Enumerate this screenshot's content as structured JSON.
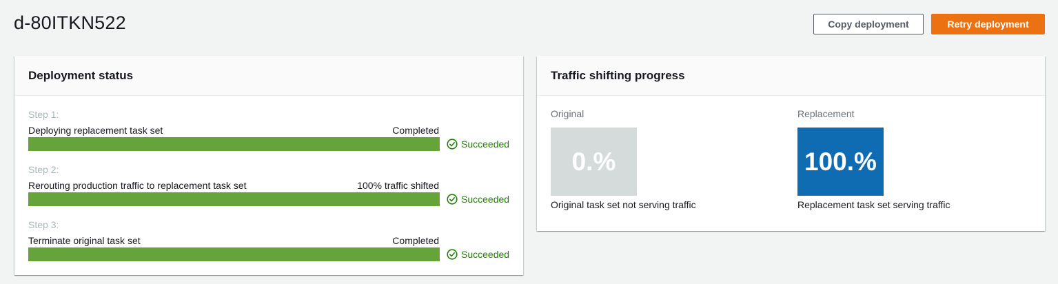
{
  "header": {
    "title": "d-80ITKN522",
    "copy_label": "Copy deployment",
    "retry_label": "Retry deployment"
  },
  "deployment_status": {
    "title": "Deployment status",
    "steps": [
      {
        "title": "Step 1:",
        "description": "Deploying replacement task set",
        "progress_text": "Completed",
        "progress": 1.0,
        "status": "Succeeded"
      },
      {
        "title": "Step 2:",
        "description": "Rerouting production traffic to replacement task set",
        "progress_text": "100% traffic shifted",
        "progress": 1.0,
        "status": "Succeeded"
      },
      {
        "title": "Step 3:",
        "description": "Terminate original task set",
        "progress_text": "Completed",
        "progress": 1.0,
        "status": "Succeeded"
      }
    ]
  },
  "traffic_shifting": {
    "title": "Traffic shifting progress",
    "original": {
      "label": "Original",
      "value": "0.%",
      "caption": "Original task set not serving traffic",
      "color": "#d5dbdb"
    },
    "replacement": {
      "label": "Replacement",
      "value": "100.%",
      "caption": "Replacement task set serving traffic",
      "color": "#0f6cb2"
    }
  },
  "colors": {
    "accent": "#ec7211",
    "success": "#1d8102",
    "bar_fill": "#67a33b"
  },
  "icons": {
    "status": "check-circle-icon"
  }
}
